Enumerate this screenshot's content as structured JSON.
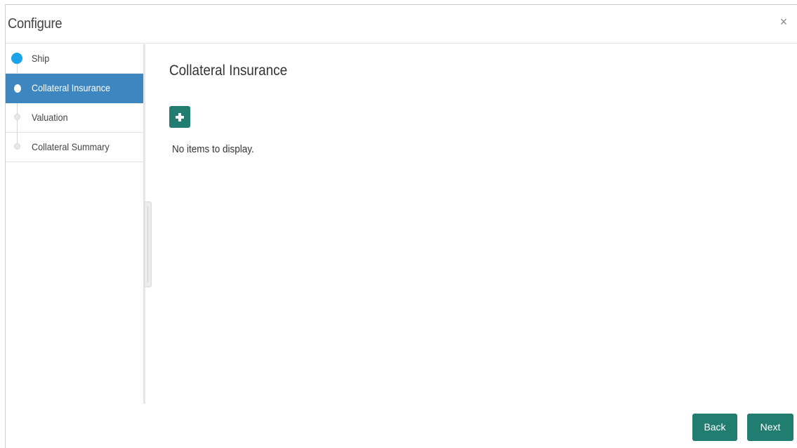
{
  "dialog": {
    "title": "Configure",
    "close_label": "×"
  },
  "sidebar": {
    "steps": [
      {
        "label": "Ship",
        "state": "done"
      },
      {
        "label": "Collateral Insurance",
        "state": "active"
      },
      {
        "label": "Valuation",
        "state": "pending"
      },
      {
        "label": "Collateral Summary",
        "state": "pending"
      }
    ]
  },
  "main": {
    "title": "Collateral Insurance",
    "empty_message": "No items to display."
  },
  "footer": {
    "back_label": "Back",
    "next_label": "Next"
  },
  "colors": {
    "accent": "#207d6f",
    "active_step": "#3d86bf",
    "done_dot": "#1aa3e8"
  }
}
